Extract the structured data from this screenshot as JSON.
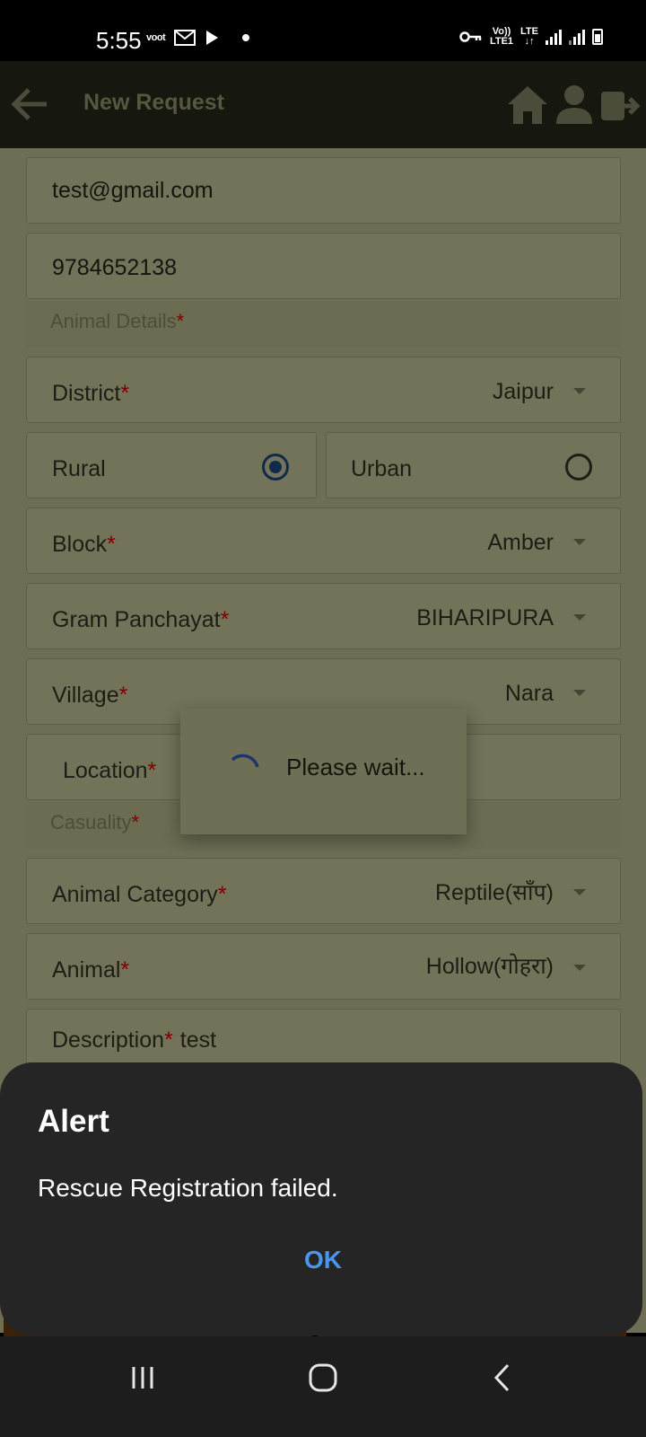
{
  "status_bar": {
    "time": "5:55",
    "carrier_badge": "voot",
    "volte": "Vo))",
    "lte_top": "LTE",
    "lte1": "LTE1"
  },
  "app_bar": {
    "title": "New Request",
    "icons": [
      "back-arrow-icon",
      "home-icon",
      "profile-icon",
      "logout-icon"
    ]
  },
  "form": {
    "email": "test@gmail.com",
    "phone": "9784652138",
    "animal_details_label": "Animal Details",
    "district": {
      "label": "District",
      "value": "Jaipur"
    },
    "area": {
      "rural_label": "Rural",
      "urban_label": "Urban",
      "selected": "Rural"
    },
    "block": {
      "label": "Block",
      "value": "Amber"
    },
    "gram_panchayat": {
      "label": "Gram Panchayat",
      "value": "BIHARIPURA"
    },
    "village": {
      "label": "Village",
      "value": "Nara"
    },
    "location": {
      "label": "Location"
    },
    "casuality_label": "Casuality",
    "animal_category": {
      "label": "Animal Category",
      "value": "Reptile(साँप)"
    },
    "animal": {
      "label": "Animal",
      "value": "Hollow(गोहरा)"
    },
    "description": {
      "label": "Description",
      "value": "test"
    },
    "required_mark": "*"
  },
  "progress_dialog": {
    "text": "Please wait..."
  },
  "alert_dialog": {
    "title": "Alert",
    "message": "Rescue Registration failed.",
    "ok_label": "OK"
  },
  "colors": {
    "alert_bg": "#252525",
    "ok_accent": "#4a95ee",
    "app_bar_dimmed": "#16180f",
    "required_star": "#7a0000"
  }
}
